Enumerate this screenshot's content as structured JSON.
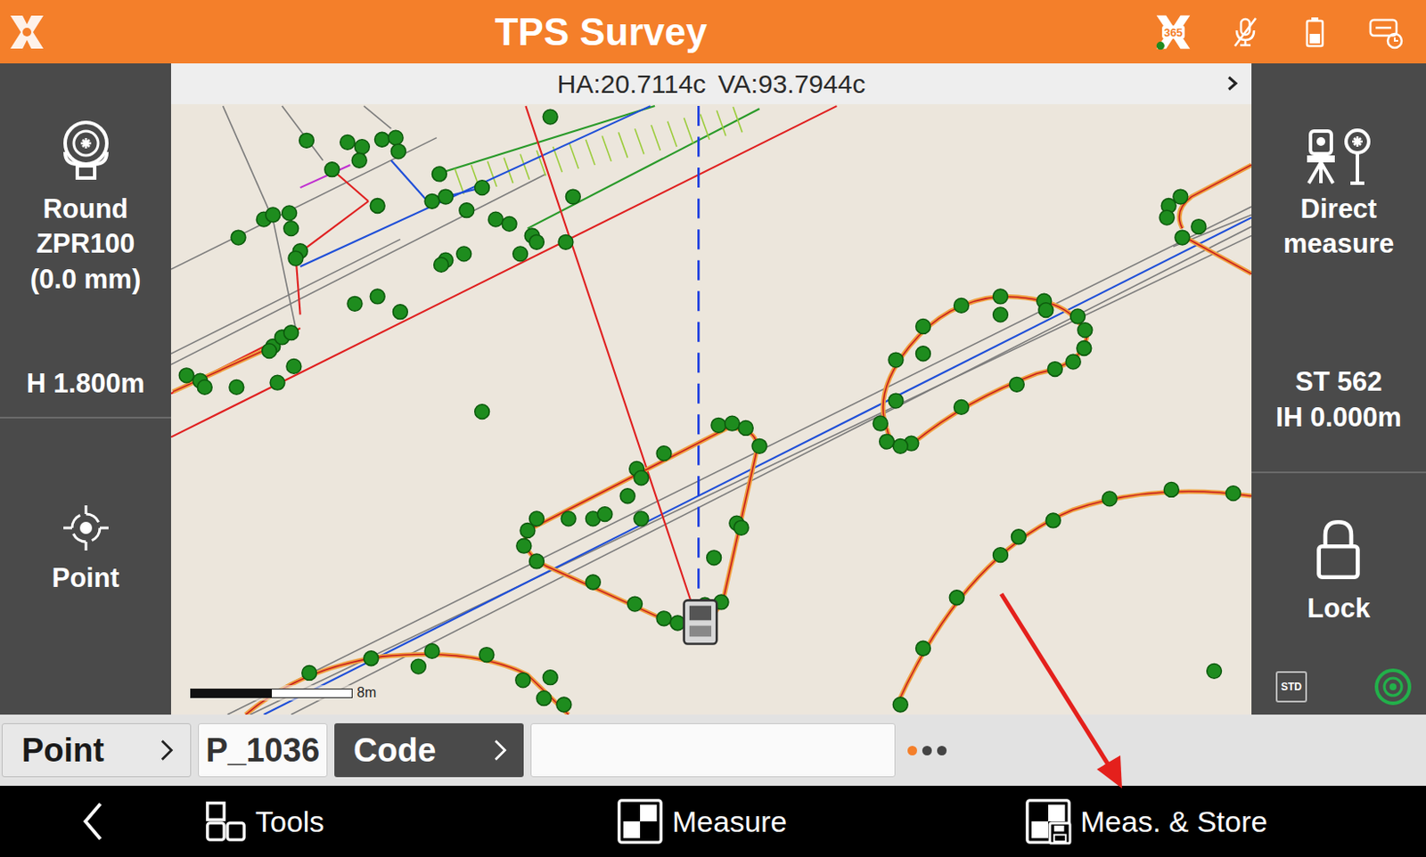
{
  "app_bar": {
    "title": "TPS Survey",
    "status_badge": "365"
  },
  "angles": {
    "ha": "HA:20.7114c",
    "va": "VA:93.7944c"
  },
  "left_panel": {
    "prism": {
      "lines": [
        "Round",
        "ZPR100",
        "(0.0 mm)"
      ],
      "height": "H 1.800m"
    },
    "mode": {
      "label": "Point"
    }
  },
  "right_panel": {
    "measure_mode": {
      "lines": [
        "Direct",
        "measure"
      ]
    },
    "station": {
      "lines": [
        "ST 562",
        "IH 0.000m"
      ]
    },
    "lock": {
      "label": "Lock",
      "locked": true
    },
    "std": "STD"
  },
  "map": {
    "scale": "8m"
  },
  "fields": [
    {
      "label": "Point",
      "value": "P_1036",
      "selected": true
    },
    {
      "label": "Code",
      "value": "",
      "selected": false
    }
  ],
  "pager": {
    "dots": [
      {
        "selected": true
      },
      {
        "selected": false
      },
      {
        "selected": false
      }
    ]
  },
  "toolbar": {
    "buttons": [
      {
        "label": "Tools",
        "kind": "tools"
      },
      {
        "label": "Measure",
        "kind": "measure"
      },
      {
        "label": "Meas. & Store",
        "kind": "store"
      }
    ]
  },
  "annotations": [
    {
      "kind": "arrow",
      "target": "Meas. & Store"
    }
  ]
}
